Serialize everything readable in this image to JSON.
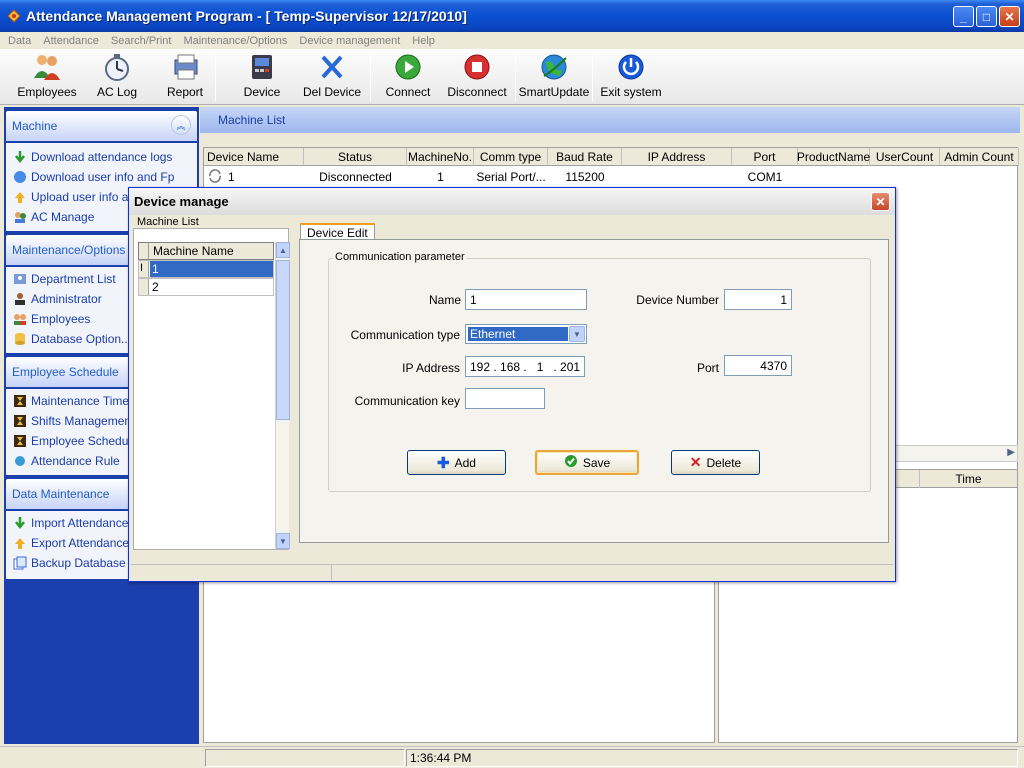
{
  "window": {
    "title": "Attendance Management Program - [ Temp-Supervisor 12/17/2010]"
  },
  "menu": [
    "Data",
    "Attendance",
    "Search/Print",
    "Maintenance/Options",
    "Device management",
    "Help"
  ],
  "toolbar": {
    "employees": "Employees",
    "ac_log": "AC Log",
    "report": "Report",
    "device": "Device",
    "del_device": "Del Device",
    "connect": "Connect",
    "disconnect": "Disconnect",
    "smartupdate": "SmartUpdate",
    "exit": "Exit system"
  },
  "sidebar": {
    "machine": {
      "header": "Machine",
      "items": [
        "Download attendance logs",
        "Download user info and Fp",
        "Upload user info and",
        "AC Manage"
      ]
    },
    "maintenance": {
      "header": "Maintenance/Options",
      "items": [
        "Department List",
        "Administrator",
        "Employees",
        "Database Option..."
      ]
    },
    "schedule": {
      "header": "Employee Schedule",
      "items": [
        "Maintenance Timetal",
        "Shifts Management",
        "Employee Schedule",
        "Attendance Rule"
      ]
    },
    "datamaint": {
      "header": "Data Maintenance",
      "items": [
        "Import Attendance Cl",
        "Export Attendance C",
        "Backup Database"
      ]
    }
  },
  "machine_list": {
    "header": "Machine List",
    "columns": [
      "Device Name",
      "Status",
      "MachineNo.",
      "Comm type",
      "Baud Rate",
      "IP Address",
      "Port",
      "ProductName",
      "UserCount",
      "Admin Count"
    ],
    "rows": [
      [
        "1",
        "Disconnected",
        "1",
        "Serial Port/...",
        "115200",
        "",
        "COM1",
        "",
        "",
        ""
      ]
    ],
    "lower_right_header": "Time"
  },
  "status": {
    "time": "1:36:44 PM"
  },
  "dialog": {
    "title": "Device manage",
    "machine_list_label": "Machine List",
    "machine_name_header": "Machine Name",
    "machines": [
      "1",
      "2"
    ],
    "tab": "Device Edit",
    "group_label": "Communication parameter",
    "name_label": "Name",
    "name_value": "1",
    "device_number_label": "Device Number",
    "device_number_value": "1",
    "comm_type_label": "Communication type",
    "comm_type_value": "Ethernet",
    "ip_label": "IP Address",
    "ip_value": "192 . 168 .   1   . 201",
    "port_label": "Port",
    "port_value": "4370",
    "comm_key_label": "Communication key",
    "comm_key_value": "",
    "add_label": "Add",
    "save_label": "Save",
    "delete_label": "Delete"
  }
}
